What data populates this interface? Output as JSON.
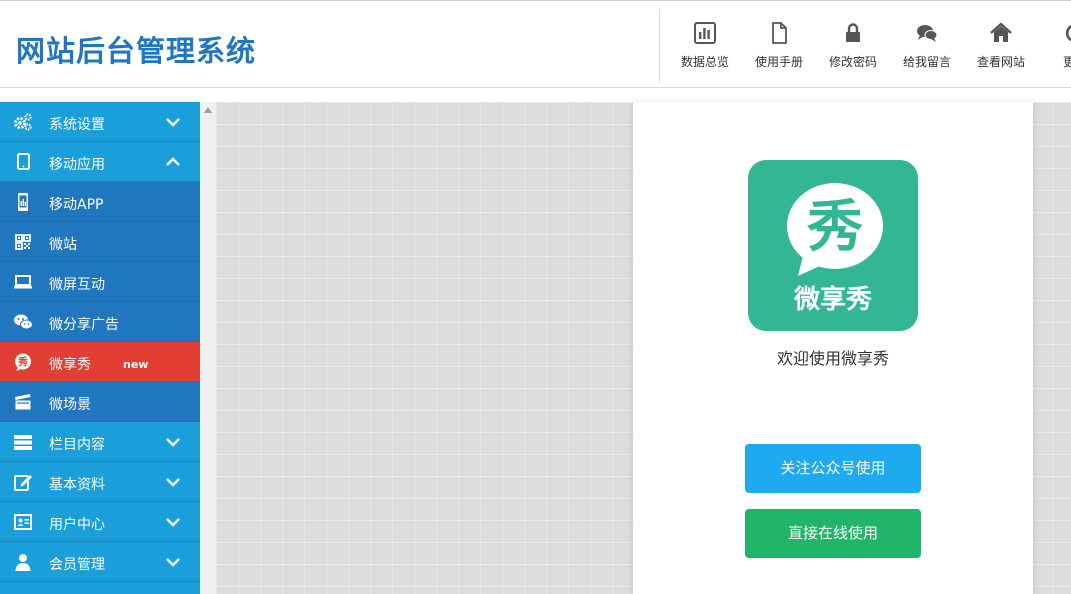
{
  "header": {
    "title": "网站后台管理系统",
    "nav": [
      {
        "label": "数据总览",
        "icon": "bar-chart-icon"
      },
      {
        "label": "使用手册",
        "icon": "document-icon"
      },
      {
        "label": "修改密码",
        "icon": "lock-icon"
      },
      {
        "label": "给我留言",
        "icon": "comments-icon"
      },
      {
        "label": "查看网站",
        "icon": "home-icon"
      },
      {
        "label": "更新",
        "icon": "refresh-icon"
      }
    ]
  },
  "sidebar": {
    "items": [
      {
        "label": "系统设置",
        "icon": "cogs-icon",
        "type": "parent",
        "expanded": false
      },
      {
        "label": "移动应用",
        "icon": "tablet-icon",
        "type": "parent",
        "expanded": true
      },
      {
        "label": "移动APP",
        "icon": "mobile-app-icon",
        "type": "sub"
      },
      {
        "label": "微站",
        "icon": "qrcode-icon",
        "type": "sub"
      },
      {
        "label": "微屏互动",
        "icon": "laptop-icon",
        "type": "sub"
      },
      {
        "label": "微分享广告",
        "icon": "wechat-icon",
        "type": "sub"
      },
      {
        "label": "微享秀",
        "icon": "xiu-icon",
        "type": "sub",
        "active": true,
        "badge": "new"
      },
      {
        "label": "微场景",
        "icon": "clapperboard-icon",
        "type": "sub"
      },
      {
        "label": "栏目内容",
        "icon": "columns-icon",
        "type": "parent",
        "expanded": false
      },
      {
        "label": "基本资料",
        "icon": "edit-icon",
        "type": "parent",
        "expanded": false
      },
      {
        "label": "用户中心",
        "icon": "user-card-icon",
        "type": "parent",
        "expanded": false
      },
      {
        "label": "会员管理",
        "icon": "user-icon",
        "type": "parent",
        "expanded": false
      }
    ]
  },
  "main": {
    "app_logo": {
      "glyph": "秀",
      "name": "微享秀"
    },
    "welcome_text": "欢迎使用微享秀",
    "follow_button": "关注公众号使用",
    "direct_button": "直接在线使用"
  },
  "colors": {
    "brand_blue": "#2176c1",
    "sidebar_bg": "#1a9fdb",
    "sidebar_sub_bg": "#2077bf",
    "active_red": "#e23e33",
    "logo_green": "#32b694",
    "follow_blue": "#1ea9f0",
    "direct_green": "#21b56a"
  }
}
